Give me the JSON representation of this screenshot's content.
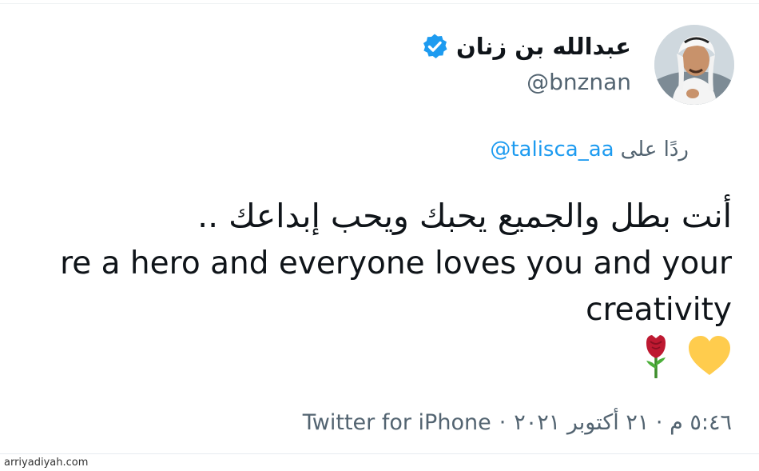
{
  "author": {
    "display_name": "عبدالله بن زنان",
    "handle": "@bnznan",
    "verified": true,
    "verified_icon": "verified-badge-icon",
    "avatar": "user-avatar-photo"
  },
  "reply": {
    "prefix": "ردًا على",
    "mention": "@talisca_aa"
  },
  "tweet": {
    "line_arabic": "أنت بطل والجميع يحبك ويحب إبداعك ..",
    "line_english_1": "re a hero and everyone loves you and your",
    "line_english_2": "creativity",
    "emojis": [
      "yellow-heart-emoji",
      "red-rose-emoji"
    ]
  },
  "meta": {
    "date": "٥:٤٦ م · ٢١ أكتوبر ٢٠٢١",
    "separator": "·",
    "source": "Twitter for iPhone"
  },
  "watermark": "arriyadiyah.com",
  "colors": {
    "text_primary": "#0f1419",
    "text_secondary": "#536471",
    "accent": "#1d9bf0",
    "heart": "#ffcc4d",
    "rose": "#be1931"
  }
}
